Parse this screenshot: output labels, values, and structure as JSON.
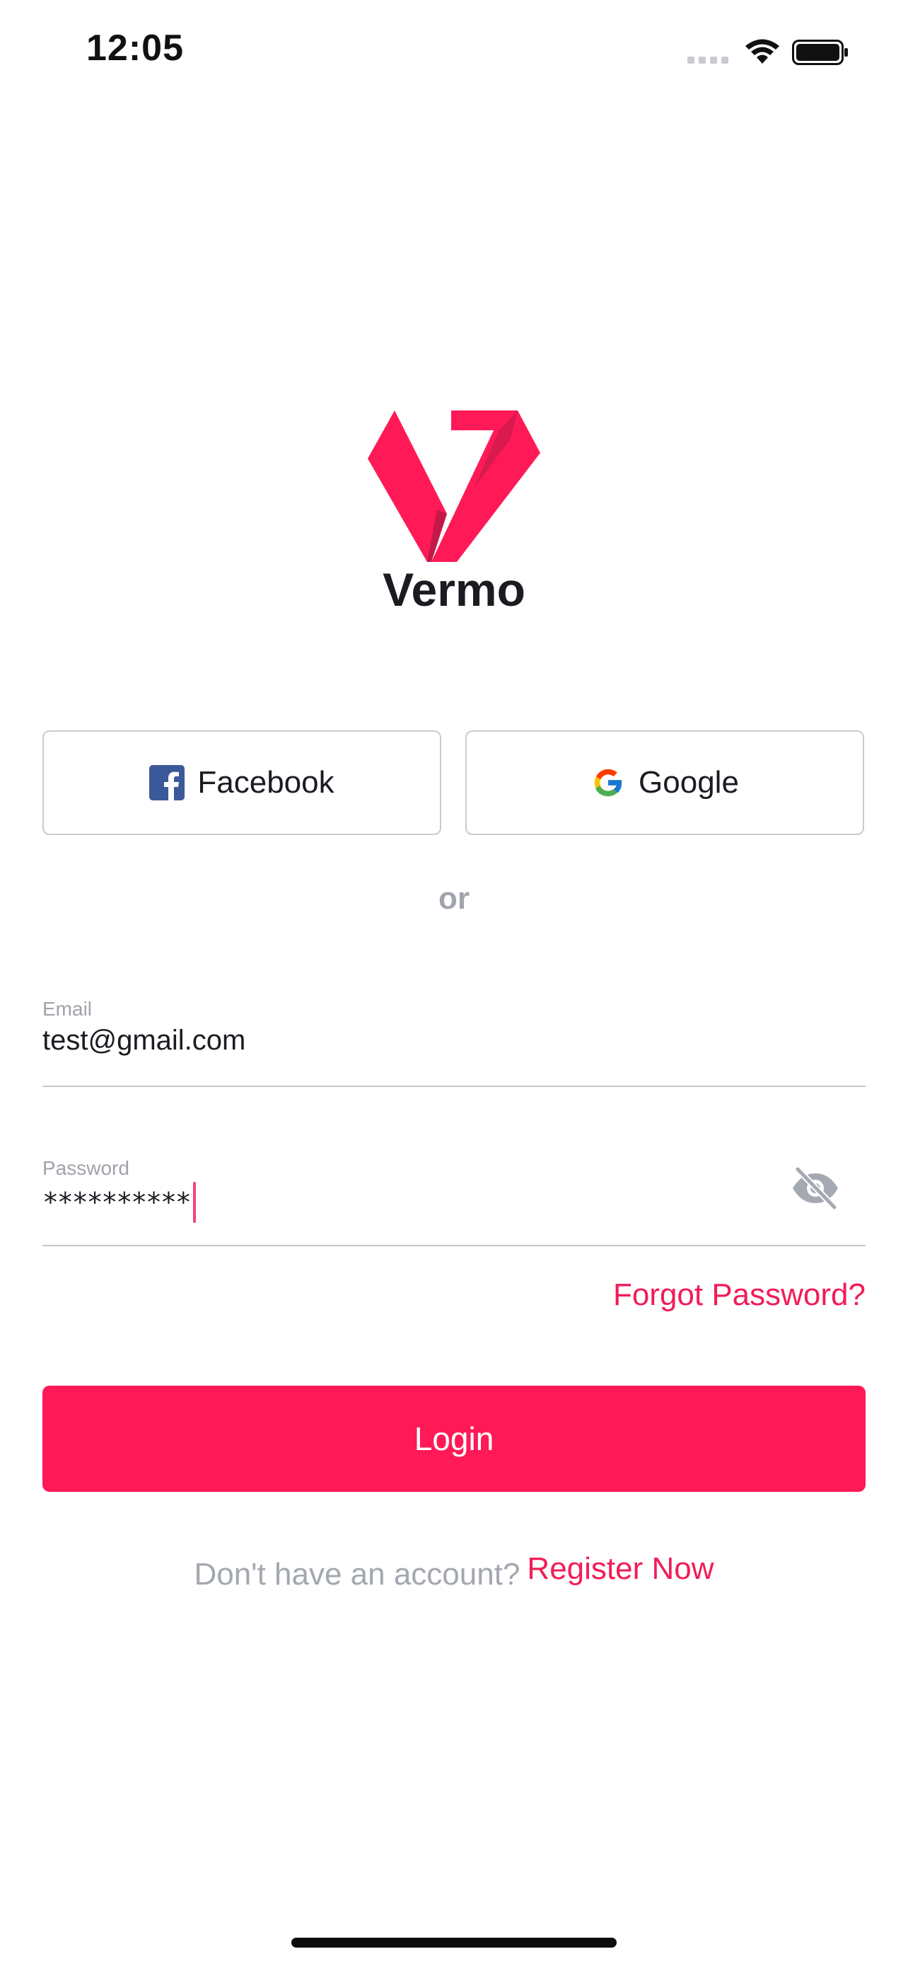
{
  "status_bar": {
    "time": "12:05",
    "icons": [
      "cellular-signal-icon",
      "wifi-icon",
      "battery-icon"
    ]
  },
  "brand": {
    "name": "Vermo",
    "logo_icon": "vermo-v-logo-icon",
    "color": "#ff1a57"
  },
  "social": {
    "facebook_label": "Facebook",
    "facebook_icon": "facebook-icon",
    "google_label": "Google",
    "google_icon": "google-icon"
  },
  "divider": {
    "text": "or"
  },
  "form": {
    "email": {
      "label": "Email",
      "value": "test@gmail.com"
    },
    "password": {
      "label": "Password",
      "value": "**********",
      "toggle_icon": "eye-off-icon"
    },
    "forgot_password": "Forgot Password?",
    "login_button": "Login"
  },
  "footer": {
    "question": "Don't have an account?",
    "register": "Register Now"
  },
  "colors": {
    "accent": "#ff1a57",
    "link": "#f21c57",
    "muted": "#a0a4ad",
    "text": "#1b1c22",
    "border": "#c8cbd2"
  }
}
